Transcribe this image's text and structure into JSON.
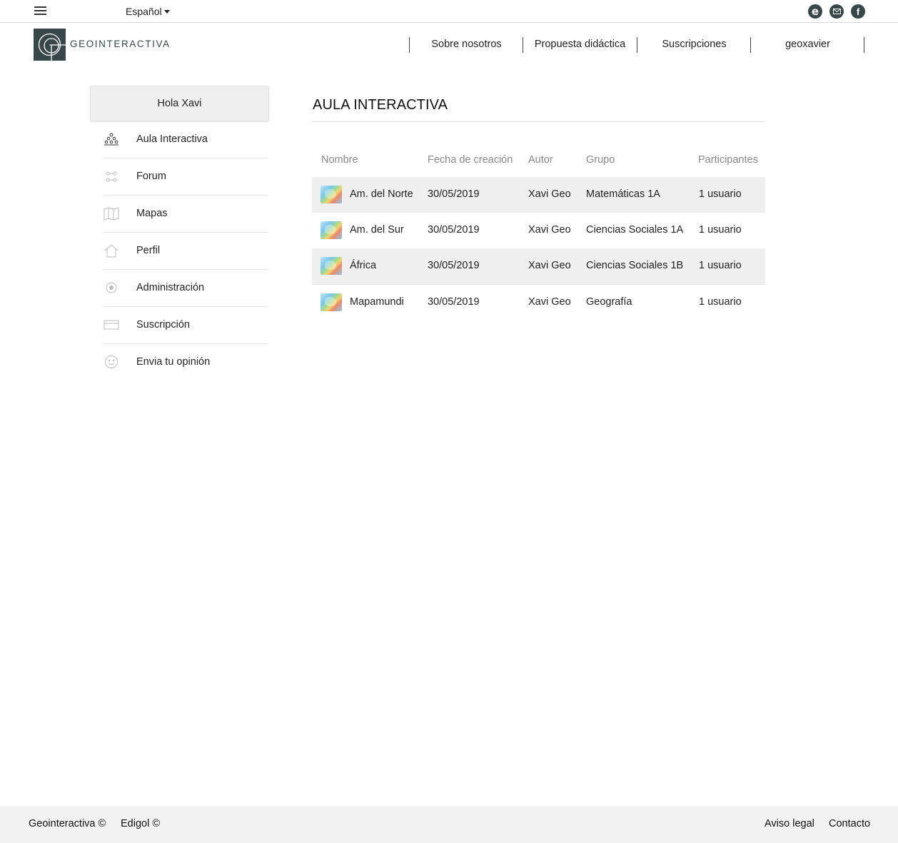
{
  "topbar": {
    "language": "Español",
    "social_e": "e",
    "social_fb": "f"
  },
  "header": {
    "brand": "GEOINTERACTIVA",
    "nav": [
      "Sobre nosotros",
      "Propuesta didáctica",
      "Suscripciones",
      "geoxavier"
    ]
  },
  "sidebar": {
    "greeting": "Hola Xavi",
    "items": [
      {
        "label": "Aula Interactiva",
        "icon": "classroom-icon"
      },
      {
        "label": "Forum",
        "icon": "forum-icon"
      },
      {
        "label": "Mapas",
        "icon": "map-icon"
      },
      {
        "label": "Perfil",
        "icon": "home-icon"
      },
      {
        "label": "Administración",
        "icon": "gear-icon"
      },
      {
        "label": "Suscripción",
        "icon": "credit-card-icon"
      },
      {
        "label": "Envia tu opinión",
        "icon": "smiley-icon"
      }
    ]
  },
  "main": {
    "title": "AULA INTERACTIVA",
    "columns": [
      "Nombre",
      "Fecha de creación",
      "Autor",
      "Grupo",
      "Participantes"
    ],
    "rows": [
      {
        "nombre": "Am. del Norte",
        "fecha": "30/05/2019",
        "autor": "Xavi Geo",
        "grupo": "Matemáticas 1A",
        "participantes": "1 usuario"
      },
      {
        "nombre": "Am. del Sur",
        "fecha": "30/05/2019",
        "autor": "Xavi Geo",
        "grupo": "Ciencias Sociales 1A",
        "participantes": "1 usuario"
      },
      {
        "nombre": "África",
        "fecha": "30/05/2019",
        "autor": "Xavi Geo",
        "grupo": "Ciencias Sociales 1B",
        "participantes": "1 usuario"
      },
      {
        "nombre": "Mapamundi",
        "fecha": "30/05/2019",
        "autor": "Xavi Geo",
        "grupo": "Geografía",
        "participantes": "1 usuario"
      }
    ]
  },
  "footer": {
    "left": [
      "Geointeractiva ©",
      "Edigol ©"
    ],
    "right": [
      "Aviso legal",
      "Contacto"
    ]
  },
  "colors": {
    "brand": "#37474a",
    "row_shade": "#efefef",
    "footer_bg": "#f2f2f2"
  }
}
